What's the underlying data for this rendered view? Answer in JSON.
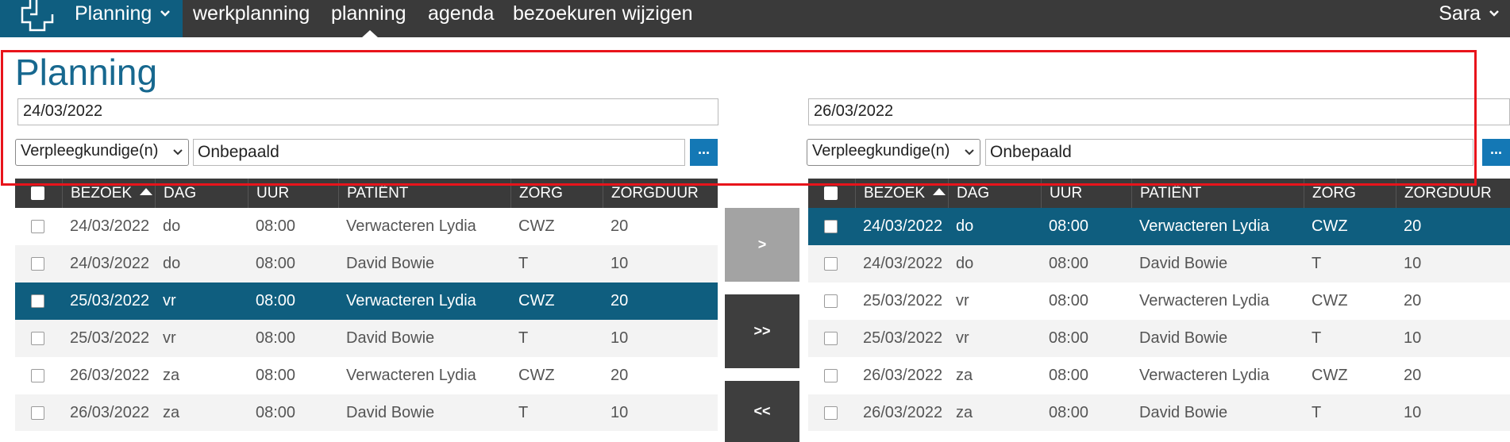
{
  "nav": {
    "brand_label": "Planning",
    "items": [
      "werkplanning",
      "planning",
      "agenda",
      "bezoekuren wijzigen"
    ],
    "user": "Sara"
  },
  "page": {
    "title": "Planning"
  },
  "left": {
    "date": "24/03/2022",
    "role": "Verpleegkundige(n)",
    "person": "Onbepaald",
    "more": "..."
  },
  "right": {
    "date": "26/03/2022",
    "role": "Verpleegkundige(n)",
    "person": "Onbepaald",
    "more": "..."
  },
  "columns": [
    "BEZOEK",
    "DAG",
    "UUR",
    "PATIËNT",
    "ZORG",
    "ZORGDUUR"
  ],
  "left_rows": [
    [
      "24/03/2022",
      "do",
      "08:00",
      "Verwacteren Lydia",
      "CWZ",
      "20"
    ],
    [
      "24/03/2022",
      "do",
      "08:00",
      "David Bowie",
      "T",
      "10"
    ],
    [
      "25/03/2022",
      "vr",
      "08:00",
      "Verwacteren Lydia",
      "CWZ",
      "20"
    ],
    [
      "25/03/2022",
      "vr",
      "08:00",
      "David Bowie",
      "T",
      "10"
    ],
    [
      "26/03/2022",
      "za",
      "08:00",
      "Verwacteren Lydia",
      "CWZ",
      "20"
    ],
    [
      "26/03/2022",
      "za",
      "08:00",
      "David Bowie",
      "T",
      "10"
    ]
  ],
  "right_rows": [
    [
      "24/03/2022",
      "do",
      "08:00",
      "Verwacteren Lydia",
      "CWZ",
      "20"
    ],
    [
      "24/03/2022",
      "do",
      "08:00",
      "David Bowie",
      "T",
      "10"
    ],
    [
      "25/03/2022",
      "vr",
      "08:00",
      "Verwacteren Lydia",
      "CWZ",
      "20"
    ],
    [
      "25/03/2022",
      "vr",
      "08:00",
      "David Bowie",
      "T",
      "10"
    ],
    [
      "26/03/2022",
      "za",
      "08:00",
      "Verwacteren Lydia",
      "CWZ",
      "20"
    ],
    [
      "26/03/2022",
      "za",
      "08:00",
      "David Bowie",
      "T",
      "10"
    ]
  ],
  "transfer": {
    "move_one": ">",
    "move_all": ">>",
    "move_back_all": "<<"
  },
  "colors": {
    "brand": "#0f5e80",
    "nav": "#3a3a3a",
    "selected_row": "#0f5e7f",
    "highlight": "#e8141b",
    "title": "#17688f"
  }
}
